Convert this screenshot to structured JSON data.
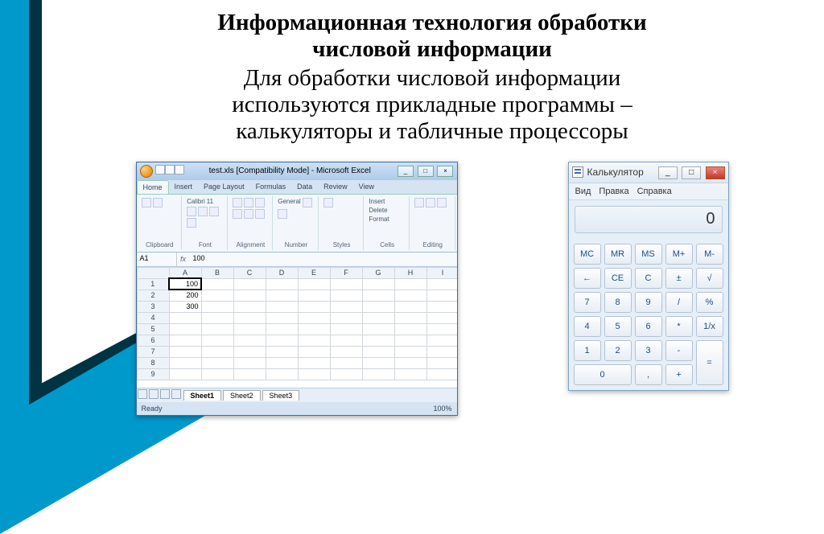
{
  "slide": {
    "title_line1": "Информационная технология обработки",
    "title_line2": "числовой информации",
    "body_line1": "Для обработки числовой информации",
    "body_line2": "используются прикладные программы –",
    "body_line3": "калькуляторы и табличные процессоры"
  },
  "excel": {
    "title": "test.xls [Compatibility Mode] - Microsoft Excel",
    "tabs": [
      "Home",
      "Insert",
      "Page Layout",
      "Formulas",
      "Data",
      "Review",
      "View"
    ],
    "ribbon_groups": [
      "Clipboard",
      "Font",
      "Alignment",
      "Number",
      "Styles",
      "Cells",
      "Editing"
    ],
    "font_name": "Calibri",
    "font_size": "11",
    "number_format": "General",
    "cells_insert": "Insert",
    "cells_delete": "Delete",
    "cells_format": "Format",
    "name_box": "A1",
    "fx_label": "fx",
    "formula_value": "100",
    "columns": [
      "A",
      "B",
      "C",
      "D",
      "E",
      "F",
      "G",
      "H",
      "I"
    ],
    "rows": [
      {
        "n": "1",
        "a": "100"
      },
      {
        "n": "2",
        "a": "200"
      },
      {
        "n": "3",
        "a": "300"
      },
      {
        "n": "4",
        "a": ""
      },
      {
        "n": "5",
        "a": ""
      },
      {
        "n": "6",
        "a": ""
      },
      {
        "n": "7",
        "a": ""
      },
      {
        "n": "8",
        "a": ""
      },
      {
        "n": "9",
        "a": ""
      }
    ],
    "sheet_tabs": [
      "Sheet1",
      "Sheet2",
      "Sheet3"
    ],
    "status_ready": "Ready",
    "zoom": "100%"
  },
  "calc": {
    "title": "Калькулятор",
    "menu": [
      "Вид",
      "Правка",
      "Справка"
    ],
    "display": "0",
    "row_mem": [
      "MC",
      "MR",
      "MS",
      "M+",
      "M-"
    ],
    "row1": [
      "←",
      "CE",
      "C",
      "±",
      "√"
    ],
    "row2": [
      "7",
      "8",
      "9",
      "/",
      "%"
    ],
    "row3": [
      "4",
      "5",
      "6",
      "*",
      "1/x"
    ],
    "row4": [
      "1",
      "2",
      "3",
      "-"
    ],
    "row5_zero": "0",
    "row5_dot": ",",
    "row5_plus": "+",
    "equals": "="
  }
}
